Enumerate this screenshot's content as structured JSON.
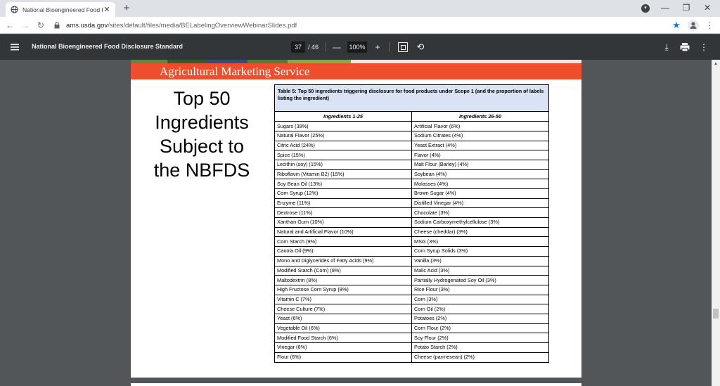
{
  "browser": {
    "tab_title": "National Bioengineered Food Dis",
    "url_host": "ams.usda.gov",
    "url_path": "/sites/default/files/media/BELabelingOverviewWebinarSlides.pdf"
  },
  "pdf_toolbar": {
    "title": "National Bioengineered Food Disclosure Standard",
    "current_page": "37",
    "total_pages": "/ 46",
    "zoom": "100%"
  },
  "slide": {
    "banner": "Agricultural Marketing Service",
    "heading_lines": [
      "Top 50",
      "Ingredients",
      "Subject to",
      "the NBFDS"
    ],
    "colors": {
      "banner": "#ee4e2b",
      "caption_bg": "#dae3f3"
    }
  },
  "table": {
    "caption": "Table 5: Top 50 ingredients triggering disclosure for food products under Scope 1 (and the proportion of labels listing the ingredient)",
    "headers": [
      "Ingredients 1-25",
      "Ingredients 26-50"
    ],
    "rows": [
      [
        "Sugars (39%)",
        "Artificial Flavor (6%)"
      ],
      [
        "Natural Flavor (25%)",
        "Sodium Citrates (4%)"
      ],
      [
        "Citric Acid (24%)",
        "Yeast Extract (4%)"
      ],
      [
        "Spice (15%)",
        "Flavor (4%)"
      ],
      [
        "Lecithin (soy) (15%)",
        "Malt Flour (Barley) (4%)"
      ],
      [
        "Riboflavin (Vitamin B2) (15%)",
        "Soybean (4%)"
      ],
      [
        "Soy Bean Oil (13%)",
        "Molasses (4%)"
      ],
      [
        "Corn Syrup (12%)",
        "Brown Sugar (4%)"
      ],
      [
        "Enzyme (11%)",
        "Distilled Vinegar (4%)"
      ],
      [
        "Dextrose (11%)",
        "Chocolate (3%)"
      ],
      [
        "Xanthan Gum (10%)",
        "Sodium Carboxymethylcellulose (3%)"
      ],
      [
        "Natural and Artificial Flavor (10%)",
        "Cheese (cheddar) (3%)"
      ],
      [
        "Corn Starch (9%)",
        "MSG (3%)"
      ],
      [
        "Canola Oil (9%)",
        "Corn Syrup Solids (3%)"
      ],
      [
        "Mono and Diglycerides of Fatty Acids (9%)",
        "Vanilla (3%)"
      ],
      [
        "Modified Starch (Corn) (8%)",
        "Malic Acid (3%)"
      ],
      [
        "Maltodextrin (8%)",
        "Partially Hydrogenated Soy Oil (3%)"
      ],
      [
        "High Fructose Corn Syrup (8%)",
        "Rice Flour (3%)"
      ],
      [
        "Vitamin C (7%)",
        "Corn (3%)"
      ],
      [
        "Cheese Culture (7%)",
        "Corn Oil (2%)"
      ],
      [
        "Yeast (6%)",
        "Potatoes (2%)"
      ],
      [
        "Vegetable Oil (6%)",
        "Corn Flour (2%)"
      ],
      [
        "Modified Food Starch (6%)",
        "Soy Flour (2%)"
      ],
      [
        "Vinegar (6%)",
        "Potato Starch (2%)"
      ],
      [
        "Flour (6%)",
        "Cheese (parmesean) (2%)"
      ]
    ]
  }
}
